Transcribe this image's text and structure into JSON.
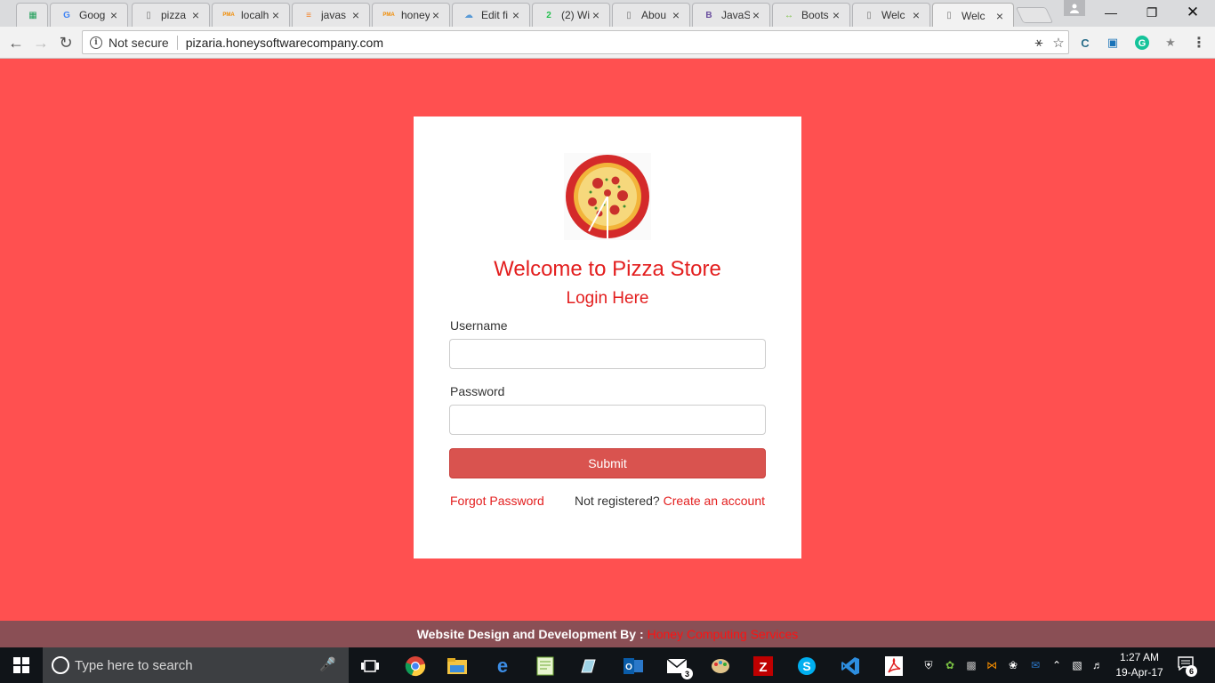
{
  "browser": {
    "tabs": [
      {
        "title": "",
        "favicon": "sheets-icon",
        "favcolor": "#1e9e58",
        "glyph": "▦"
      },
      {
        "title": "Goog",
        "favicon": "google-icon",
        "favcolor": "#4285f4",
        "glyph": "G"
      },
      {
        "title": "pizza",
        "favicon": "page-icon",
        "favcolor": "#777777",
        "glyph": "▯"
      },
      {
        "title": "localh",
        "favicon": "phpmyadmin-icon",
        "favcolor": "#f08a00",
        "glyph": "PMA"
      },
      {
        "title": "javas",
        "favicon": "stackoverflow-icon",
        "favcolor": "#f48024",
        "glyph": "≡"
      },
      {
        "title": "honey",
        "favicon": "phpmyadmin-icon",
        "favcolor": "#f08a00",
        "glyph": "PMA"
      },
      {
        "title": "Edit fi",
        "favicon": "cloud-icon",
        "favcolor": "#5a9ad6",
        "glyph": "☁"
      },
      {
        "title": "(2) Wi",
        "favicon": "whatsapp-icon",
        "favcolor": "#25c04f",
        "glyph": "2"
      },
      {
        "title": "Abou",
        "favicon": "page-icon",
        "favcolor": "#777777",
        "glyph": "▯"
      },
      {
        "title": "JavaS",
        "favicon": "bootstrap-icon",
        "favcolor": "#6b4f9f",
        "glyph": "B"
      },
      {
        "title": "Boots",
        "favicon": "code-icon",
        "favcolor": "#7ac143",
        "glyph": "↔"
      },
      {
        "title": "Welc",
        "favicon": "page-icon",
        "favcolor": "#777777",
        "glyph": "▯"
      },
      {
        "title": "Welc",
        "favicon": "page-icon",
        "favcolor": "#777777",
        "glyph": "▯"
      }
    ],
    "security_label": "Not secure",
    "url": "pizaria.honeysoftwarecompany.com"
  },
  "login": {
    "heading": "Welcome to Pizza Store",
    "subheading": "Login Here",
    "username_label": "Username",
    "username_value": "",
    "password_label": "Password",
    "password_value": "",
    "submit_label": "Submit",
    "forgot_label": "Forgot Password",
    "register_prompt": "Not registered?",
    "register_link": "Create an account"
  },
  "footer": {
    "credit": "Website Design and Development By :",
    "brand": "Honey Computing Services"
  },
  "taskbar": {
    "search_placeholder": "Type here to search",
    "mail_badge": "3",
    "time": "1:27 AM",
    "date": "19-Apr-17",
    "notification_count": "6"
  },
  "colors": {
    "page_background": "#ff5050",
    "accent_red": "#e31e1e",
    "submit_button": "#d9534f",
    "footer_background": "#8a4f55"
  }
}
